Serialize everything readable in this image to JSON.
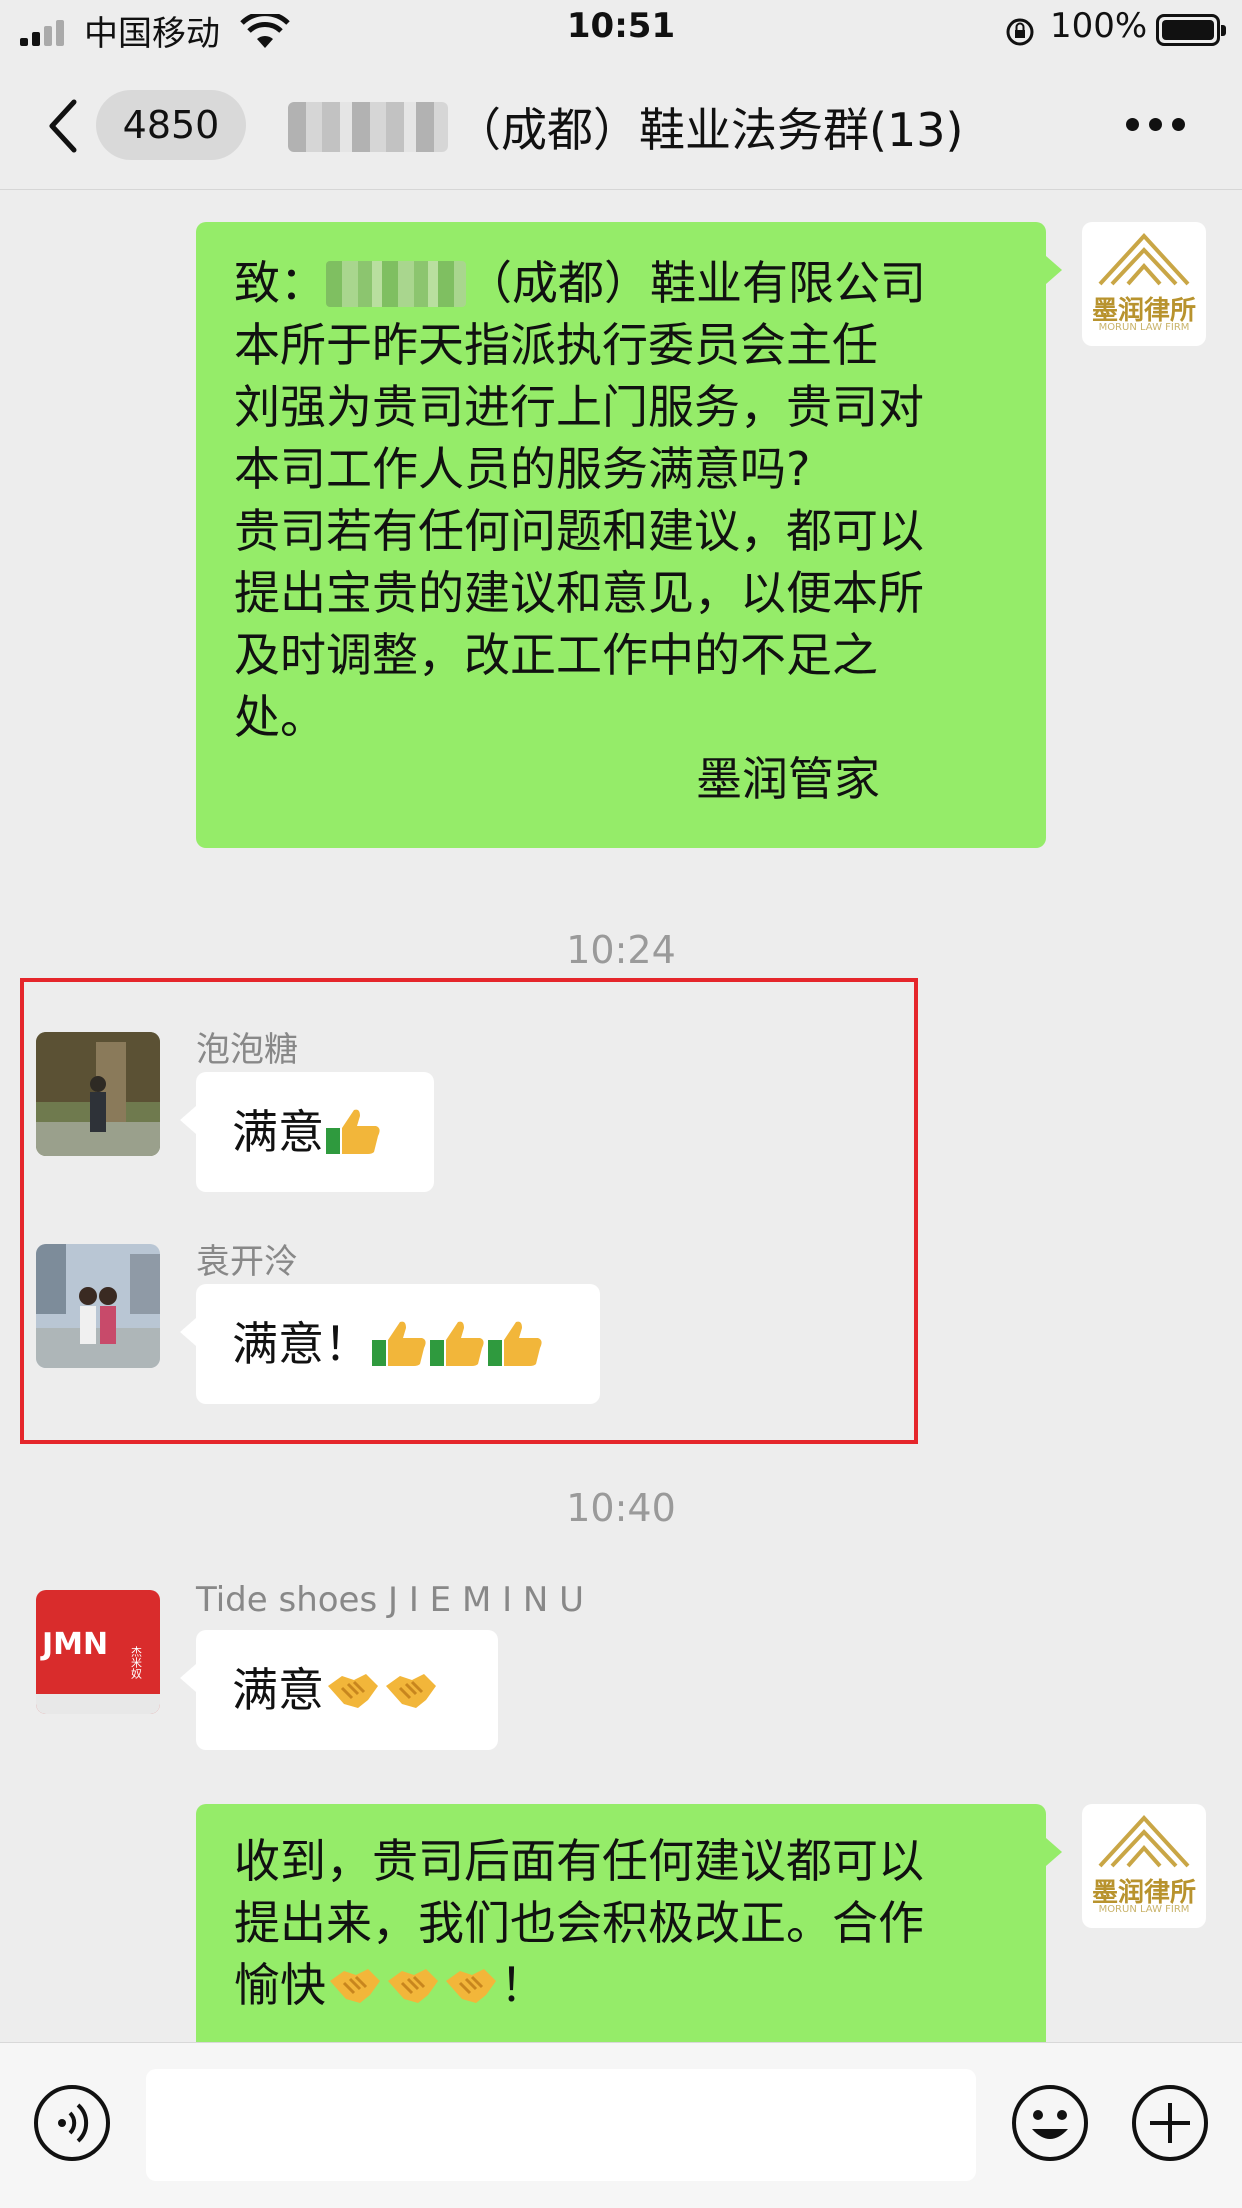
{
  "status_bar": {
    "carrier": "中国移动",
    "time": "10:51",
    "battery": "100%"
  },
  "nav": {
    "back_count": "4850",
    "title": "（成都）鞋业法务群(13)"
  },
  "messages": {
    "m1": {
      "lines": [
        "致：",
        "（成都）鞋业有限公司",
        " 本所于昨天指派执行委员会主任",
        "刘强为贵司进行上门服务，贵司对",
        "本司工作人员的服务满意吗?",
        "贵司若有任何问题和建议，都可以",
        "提出宝贵的建议和意见，以便本所",
        "及时调整，改正工作中的不足之",
        "处。"
      ],
      "signature": "墨润管家"
    },
    "time1": "10:24",
    "m2": {
      "sender": "泡泡糖",
      "text": "满意"
    },
    "m3": {
      "sender": "袁开泠",
      "text": "满意！"
    },
    "time2": "10:40",
    "m4": {
      "sender": "Tide shoes   J I E M I N U",
      "text": "满意"
    },
    "m5": {
      "lines": [
        "收到，贵司后面有任何建议都可以",
        "提出来，我们也会积极改正。合作",
        "愉快"
      ],
      "tail": "！"
    }
  },
  "law_avatar": {
    "name": "墨润律所",
    "sub": "MORUN LAW FIRM"
  },
  "jmn_avatar": {
    "mark": "JMN",
    "side": "杰米奴"
  },
  "colors": {
    "my_bubble": "#95ec69",
    "highlight": "#e5262b",
    "background": "#ededed"
  },
  "icons": [
    "back-arrow-icon",
    "more-icon",
    "voice-icon",
    "emoji-icon",
    "plus-icon",
    "thumbs-up-icon",
    "handshake-icon",
    "wifi-icon",
    "lock-rotation-icon",
    "battery-icon"
  ]
}
